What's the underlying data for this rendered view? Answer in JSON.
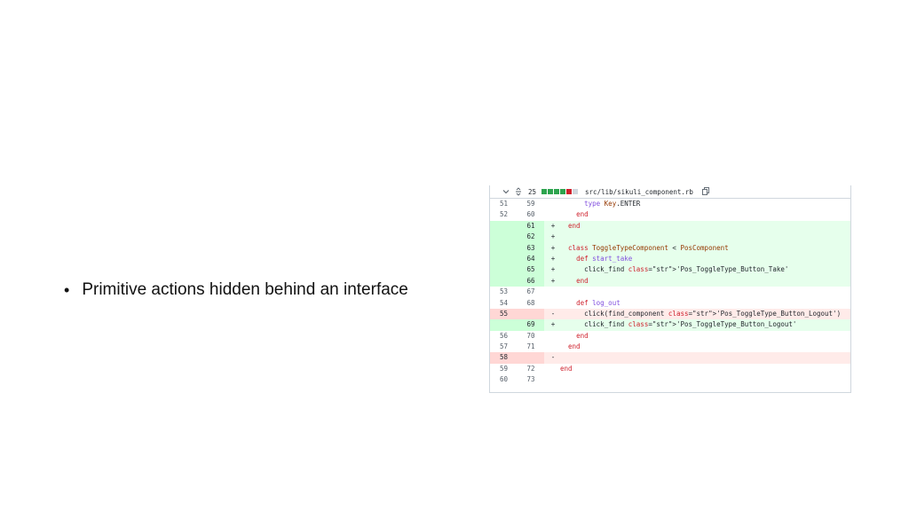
{
  "slide": {
    "bullet_symbol": "•",
    "bullet_text": "Primitive actions hidden behind an interface"
  },
  "diff": {
    "header": {
      "expand_icon": "chevron-down-icon",
      "unfold_icon": "unfold-icon",
      "changes_count": "25",
      "file_path": "src/lib/sikuli_component.rb",
      "copy_icon": "copy-icon"
    },
    "colors": {
      "addition_bg": "#e6ffec",
      "addition_num_bg": "#ccffd8",
      "deletion_bg": "#ffebe9",
      "deletion_num_bg": "#ffd7d5",
      "addition_block": "#2da44e",
      "deletion_block": "#cf222e"
    },
    "rows": [
      {
        "type": "ctx",
        "old": "51",
        "new": "59",
        "sign": "",
        "code": "      type Key.ENTER"
      },
      {
        "type": "ctx",
        "old": "52",
        "new": "60",
        "sign": "",
        "code": "    end"
      },
      {
        "type": "add",
        "old": "",
        "new": "61",
        "sign": "+",
        "code": "  end"
      },
      {
        "type": "add",
        "old": "",
        "new": "62",
        "sign": "+",
        "code": ""
      },
      {
        "type": "add",
        "old": "",
        "new": "63",
        "sign": "+",
        "code": "  class ToggleTypeComponent < PosComponent"
      },
      {
        "type": "add",
        "old": "",
        "new": "64",
        "sign": "+",
        "code": "    def start_take"
      },
      {
        "type": "add",
        "old": "",
        "new": "65",
        "sign": "+",
        "code": "      click_find 'Pos_ToggleType_Button_Take'"
      },
      {
        "type": "add",
        "old": "",
        "new": "66",
        "sign": "+",
        "code": "    end"
      },
      {
        "type": "ctx",
        "old": "53",
        "new": "67",
        "sign": "",
        "code": ""
      },
      {
        "type": "ctx",
        "old": "54",
        "new": "68",
        "sign": "",
        "code": "    def log_out"
      },
      {
        "type": "del",
        "old": "55",
        "new": "",
        "sign": "-",
        "code": "      click(find_component 'Pos_ToggleType_Button_Logout')"
      },
      {
        "type": "add",
        "old": "",
        "new": "69",
        "sign": "+",
        "code": "      click_find 'Pos_ToggleType_Button_Logout'"
      },
      {
        "type": "ctx",
        "old": "56",
        "new": "70",
        "sign": "",
        "code": "    end"
      },
      {
        "type": "ctx",
        "old": "57",
        "new": "71",
        "sign": "",
        "code": "  end"
      },
      {
        "type": "del",
        "old": "58",
        "new": "",
        "sign": "-",
        "code": ""
      },
      {
        "type": "ctx",
        "old": "59",
        "new": "72",
        "sign": "",
        "code": "end"
      },
      {
        "type": "ctx",
        "old": "60",
        "new": "73",
        "sign": "",
        "code": ""
      }
    ]
  }
}
